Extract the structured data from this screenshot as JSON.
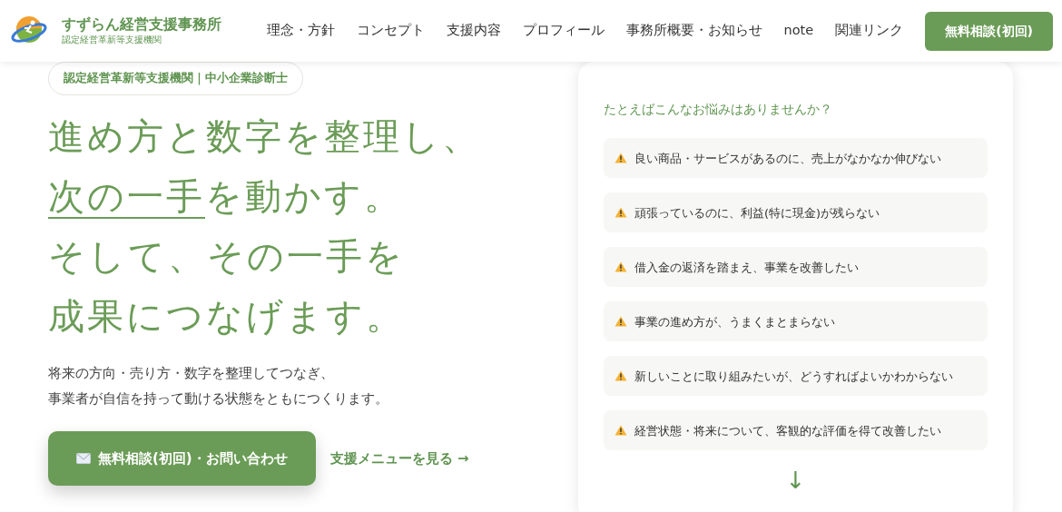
{
  "header": {
    "brand": "すずらん経営支援事務所",
    "subtitle": "認定経営革新等支援機関",
    "nav": [
      {
        "label": "理念・方針"
      },
      {
        "label": "コンセプト"
      },
      {
        "label": "支援内容"
      },
      {
        "label": "プロフィール"
      },
      {
        "label": "事務所概要・お知らせ"
      },
      {
        "label": "note"
      },
      {
        "label": "関連リンク"
      }
    ],
    "cta": "無料相談(初回)"
  },
  "hero": {
    "badge": "認定経営革新等支援機関｜中小企業診断士",
    "headline": [
      [
        {
          "text": "進め方と数字を整理し、",
          "underlined": false
        }
      ],
      [
        {
          "text": "次の一手",
          "underlined": true
        },
        {
          "text": "を動かす。",
          "underlined": false
        }
      ],
      [
        {
          "text": "そして、その一手を",
          "underlined": false
        }
      ],
      [
        {
          "text": "成果につなげます。",
          "underlined": false
        }
      ]
    ],
    "lead": [
      "将来の方向・売り方・数字を整理してつなぎ、",
      "事業者が自信を持って動ける状態をともにつくります。"
    ],
    "primary_button": "無料相談(初回)・お問い合わせ",
    "secondary_link": "支援メニューを見る →"
  },
  "worries": {
    "title": "たとえばこんなお悩みはありませんか？",
    "items": [
      {
        "text": "良い商品・サービスがあるのに、売上がなかなか伸びない"
      },
      {
        "text": "頑張っているのに、利益(特に現金)が残らない"
      },
      {
        "text": "借入金の返済を踏まえ、事業を改善したい"
      },
      {
        "text": "事業の進め方が、うまくまとまらない"
      },
      {
        "text": "新しいことに取り組みたいが、どうすればよいかわからない"
      },
      {
        "text": "経営状態・将来について、客観的な評価を得て改善したい"
      }
    ],
    "arrow": "↓"
  }
}
